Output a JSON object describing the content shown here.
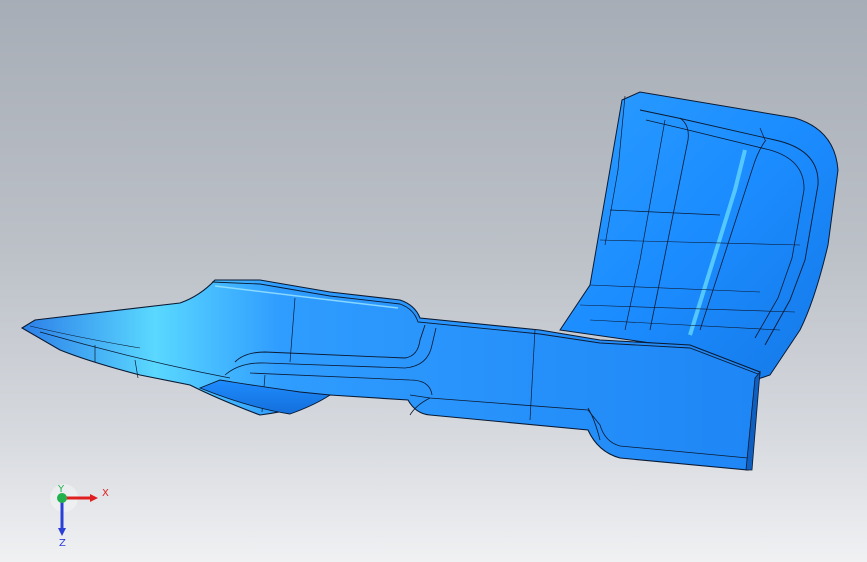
{
  "triad": {
    "x_label": "X",
    "y_label": "Y",
    "z_label": "Z"
  },
  "colors": {
    "part_blue": "#1e8fff",
    "edge": "#0a1a33",
    "axis_x": "#e02020",
    "axis_y": "#22b14c",
    "axis_z": "#2a3fd8"
  },
  "model": {
    "name_icon": "sheet-metal-part-icon"
  }
}
